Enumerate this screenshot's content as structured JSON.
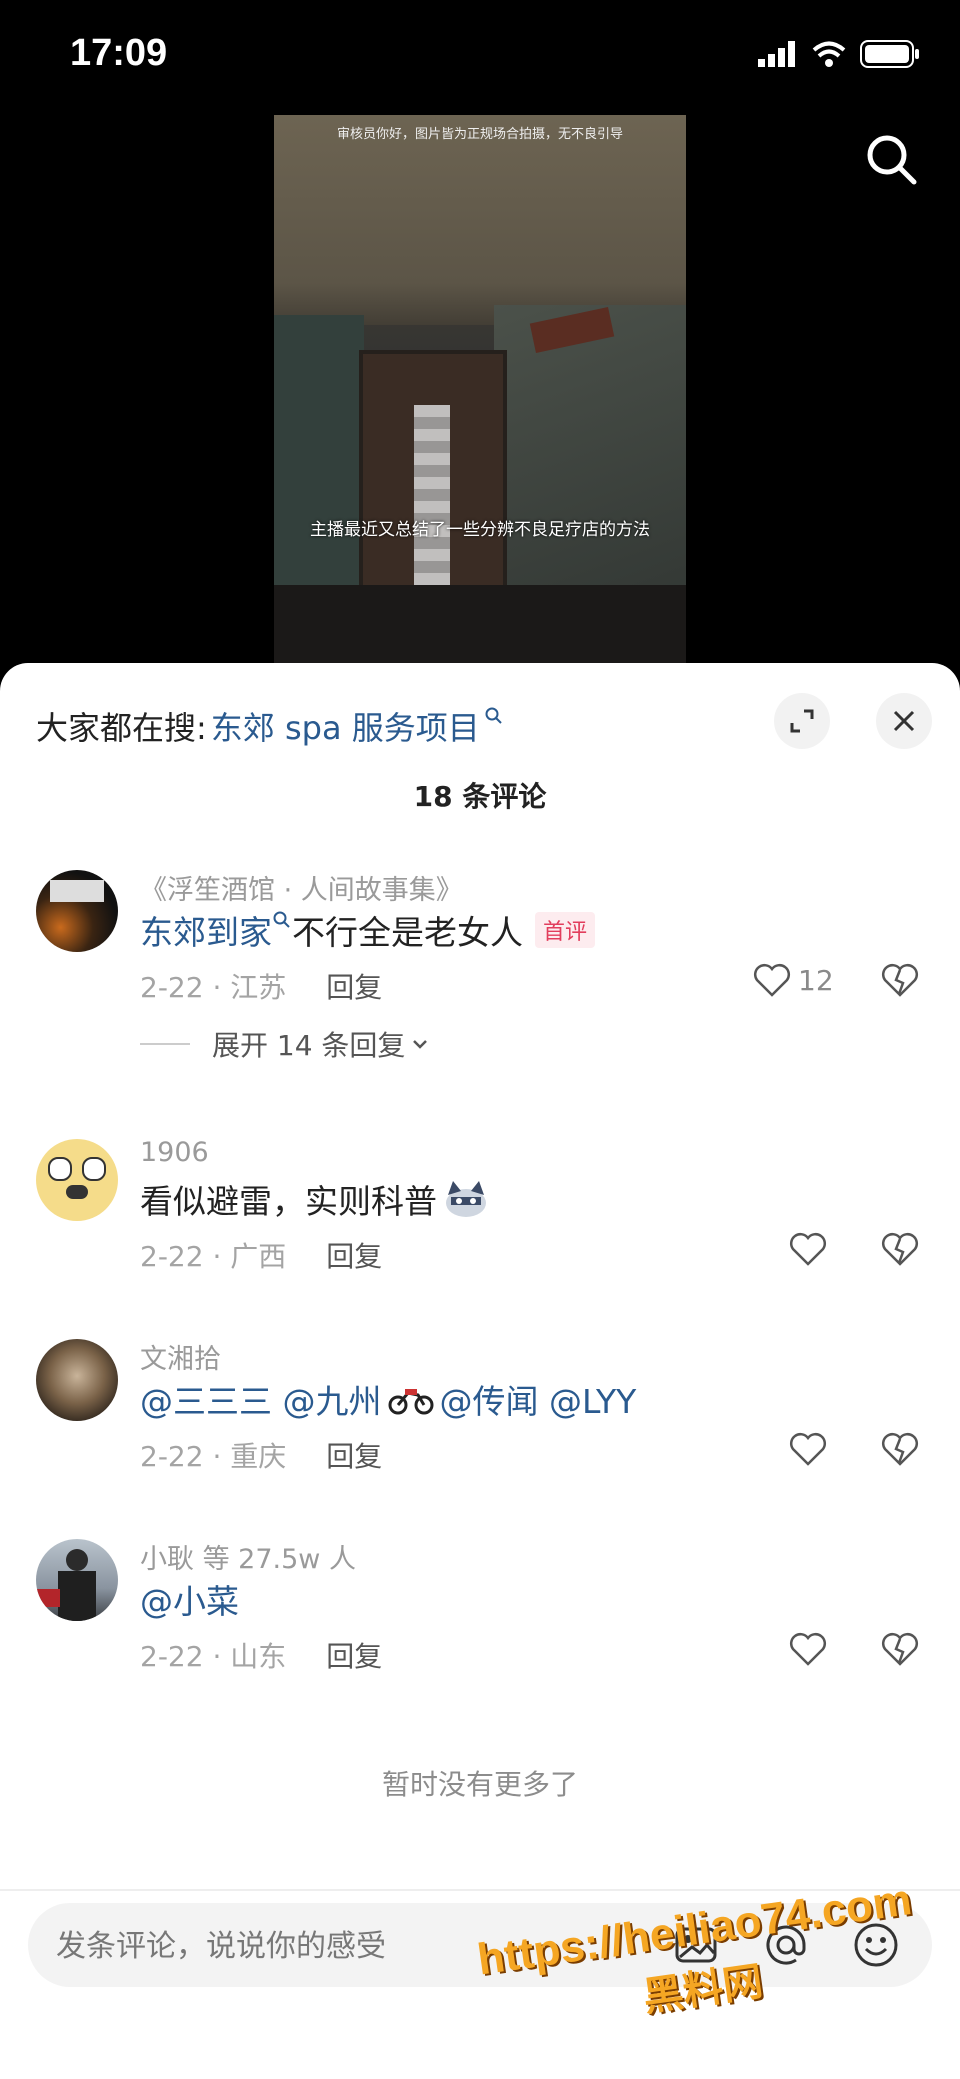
{
  "status": {
    "time": "17:09"
  },
  "video": {
    "top_notice": "审核员你好，图片皆为正规场合拍摄，无不良引导",
    "caption": "主播最近又总结了一些分辨不良足疗店的方法"
  },
  "sheet": {
    "suggest_prefix": "大家都在搜:",
    "suggest_link": "东郊 spa 服务项目",
    "comment_count": "18 条评论",
    "no_more": "暂时没有更多了"
  },
  "comments": [
    {
      "user": "《浮笙酒馆 · 人间故事集》",
      "link": "东郊到家",
      "text": "不行全是老女人",
      "tag": "首评",
      "date": "2-22 · 江苏",
      "reply": "回复",
      "likes": "12",
      "expand": "展开 14 条回复"
    },
    {
      "user": "1906",
      "text": "看似避雷，实则科普",
      "date": "2-22 · 广西",
      "reply": "回复"
    },
    {
      "user": "文湘拾",
      "mentions": "@三三三  @九州",
      "mentions2": "@传闻  @LYY",
      "date": "2-22 · 重庆",
      "reply": "回复"
    },
    {
      "user": "小耿  等 27.5w 人",
      "mentions": "@小菜",
      "date": "2-22 · 山东",
      "reply": "回复"
    }
  ],
  "input": {
    "placeholder": "发条评论，说说你的感受"
  },
  "watermark": {
    "line1": "https://heiliao74.com",
    "line2": "黑料网"
  },
  "colors": {
    "link": "#2a5a8f",
    "tag": "#e23d5c",
    "watermark": "#f5a623"
  }
}
